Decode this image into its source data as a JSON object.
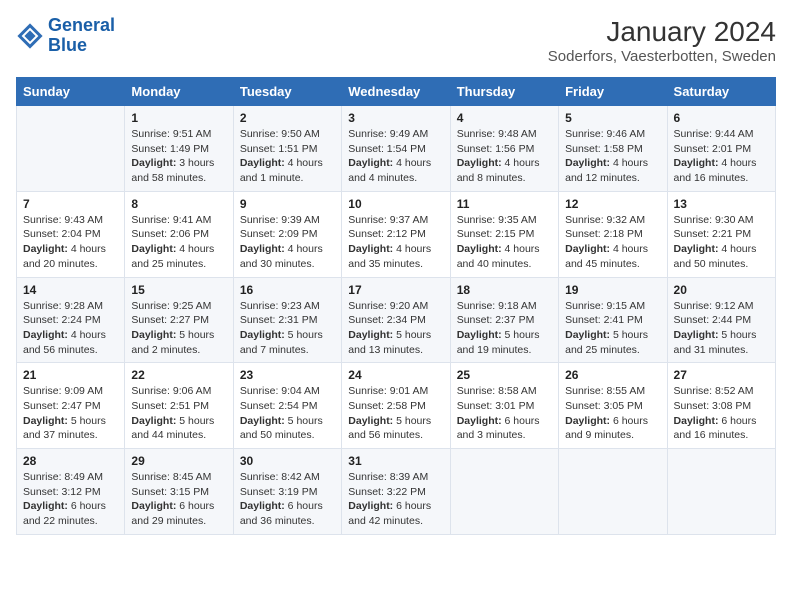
{
  "header": {
    "logo_line1": "General",
    "logo_line2": "Blue",
    "title": "January 2024",
    "subtitle": "Soderfors, Vaesterbotten, Sweden"
  },
  "weekdays": [
    "Sunday",
    "Monday",
    "Tuesday",
    "Wednesday",
    "Thursday",
    "Friday",
    "Saturday"
  ],
  "weeks": [
    [
      {
        "day": "",
        "sunrise": "",
        "sunset": "",
        "daylight": ""
      },
      {
        "day": "1",
        "sunrise": "9:51 AM",
        "sunset": "1:49 PM",
        "daylight": "3 hours and 58 minutes."
      },
      {
        "day": "2",
        "sunrise": "9:50 AM",
        "sunset": "1:51 PM",
        "daylight": "4 hours and 1 minute."
      },
      {
        "day": "3",
        "sunrise": "9:49 AM",
        "sunset": "1:54 PM",
        "daylight": "4 hours and 4 minutes."
      },
      {
        "day": "4",
        "sunrise": "9:48 AM",
        "sunset": "1:56 PM",
        "daylight": "4 hours and 8 minutes."
      },
      {
        "day": "5",
        "sunrise": "9:46 AM",
        "sunset": "1:58 PM",
        "daylight": "4 hours and 12 minutes."
      },
      {
        "day": "6",
        "sunrise": "9:44 AM",
        "sunset": "2:01 PM",
        "daylight": "4 hours and 16 minutes."
      }
    ],
    [
      {
        "day": "7",
        "sunrise": "9:43 AM",
        "sunset": "2:04 PM",
        "daylight": "4 hours and 20 minutes."
      },
      {
        "day": "8",
        "sunrise": "9:41 AM",
        "sunset": "2:06 PM",
        "daylight": "4 hours and 25 minutes."
      },
      {
        "day": "9",
        "sunrise": "9:39 AM",
        "sunset": "2:09 PM",
        "daylight": "4 hours and 30 minutes."
      },
      {
        "day": "10",
        "sunrise": "9:37 AM",
        "sunset": "2:12 PM",
        "daylight": "4 hours and 35 minutes."
      },
      {
        "day": "11",
        "sunrise": "9:35 AM",
        "sunset": "2:15 PM",
        "daylight": "4 hours and 40 minutes."
      },
      {
        "day": "12",
        "sunrise": "9:32 AM",
        "sunset": "2:18 PM",
        "daylight": "4 hours and 45 minutes."
      },
      {
        "day": "13",
        "sunrise": "9:30 AM",
        "sunset": "2:21 PM",
        "daylight": "4 hours and 50 minutes."
      }
    ],
    [
      {
        "day": "14",
        "sunrise": "9:28 AM",
        "sunset": "2:24 PM",
        "daylight": "4 hours and 56 minutes."
      },
      {
        "day": "15",
        "sunrise": "9:25 AM",
        "sunset": "2:27 PM",
        "daylight": "5 hours and 2 minutes."
      },
      {
        "day": "16",
        "sunrise": "9:23 AM",
        "sunset": "2:31 PM",
        "daylight": "5 hours and 7 minutes."
      },
      {
        "day": "17",
        "sunrise": "9:20 AM",
        "sunset": "2:34 PM",
        "daylight": "5 hours and 13 minutes."
      },
      {
        "day": "18",
        "sunrise": "9:18 AM",
        "sunset": "2:37 PM",
        "daylight": "5 hours and 19 minutes."
      },
      {
        "day": "19",
        "sunrise": "9:15 AM",
        "sunset": "2:41 PM",
        "daylight": "5 hours and 25 minutes."
      },
      {
        "day": "20",
        "sunrise": "9:12 AM",
        "sunset": "2:44 PM",
        "daylight": "5 hours and 31 minutes."
      }
    ],
    [
      {
        "day": "21",
        "sunrise": "9:09 AM",
        "sunset": "2:47 PM",
        "daylight": "5 hours and 37 minutes."
      },
      {
        "day": "22",
        "sunrise": "9:06 AM",
        "sunset": "2:51 PM",
        "daylight": "5 hours and 44 minutes."
      },
      {
        "day": "23",
        "sunrise": "9:04 AM",
        "sunset": "2:54 PM",
        "daylight": "5 hours and 50 minutes."
      },
      {
        "day": "24",
        "sunrise": "9:01 AM",
        "sunset": "2:58 PM",
        "daylight": "5 hours and 56 minutes."
      },
      {
        "day": "25",
        "sunrise": "8:58 AM",
        "sunset": "3:01 PM",
        "daylight": "6 hours and 3 minutes."
      },
      {
        "day": "26",
        "sunrise": "8:55 AM",
        "sunset": "3:05 PM",
        "daylight": "6 hours and 9 minutes."
      },
      {
        "day": "27",
        "sunrise": "8:52 AM",
        "sunset": "3:08 PM",
        "daylight": "6 hours and 16 minutes."
      }
    ],
    [
      {
        "day": "28",
        "sunrise": "8:49 AM",
        "sunset": "3:12 PM",
        "daylight": "6 hours and 22 minutes."
      },
      {
        "day": "29",
        "sunrise": "8:45 AM",
        "sunset": "3:15 PM",
        "daylight": "6 hours and 29 minutes."
      },
      {
        "day": "30",
        "sunrise": "8:42 AM",
        "sunset": "3:19 PM",
        "daylight": "6 hours and 36 minutes."
      },
      {
        "day": "31",
        "sunrise": "8:39 AM",
        "sunset": "3:22 PM",
        "daylight": "6 hours and 42 minutes."
      },
      {
        "day": "",
        "sunrise": "",
        "sunset": "",
        "daylight": ""
      },
      {
        "day": "",
        "sunrise": "",
        "sunset": "",
        "daylight": ""
      },
      {
        "day": "",
        "sunrise": "",
        "sunset": "",
        "daylight": ""
      }
    ]
  ]
}
